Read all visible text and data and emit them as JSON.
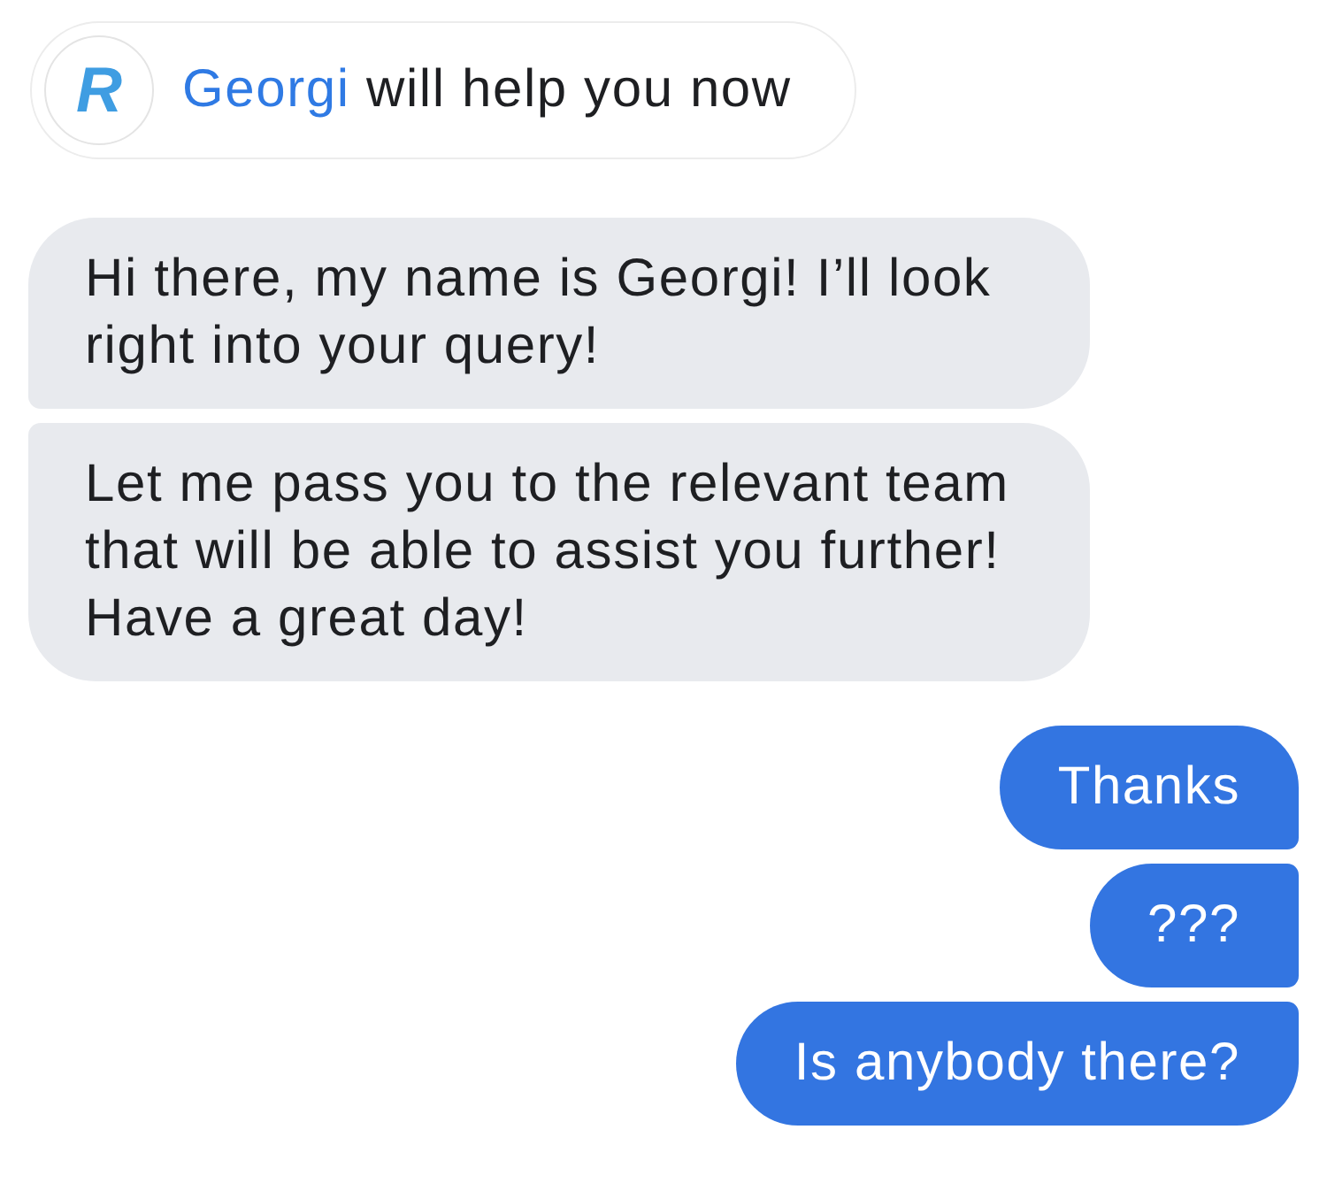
{
  "header": {
    "logo_letter": "R",
    "agent_name": "Georgi",
    "text": "will help you now"
  },
  "messages": [
    {
      "kind": "incoming",
      "text": "Hi there, my name is Georgi! I’ll look right into your query!"
    },
    {
      "kind": "incoming",
      "text": "Let me pass you to the relevant team that will be able to assist you further! Have a great day!"
    },
    {
      "kind": "outgoing",
      "text": "Thanks"
    },
    {
      "kind": "outgoing",
      "text": "???"
    },
    {
      "kind": "outgoing",
      "text": "Is anybody there?"
    }
  ]
}
